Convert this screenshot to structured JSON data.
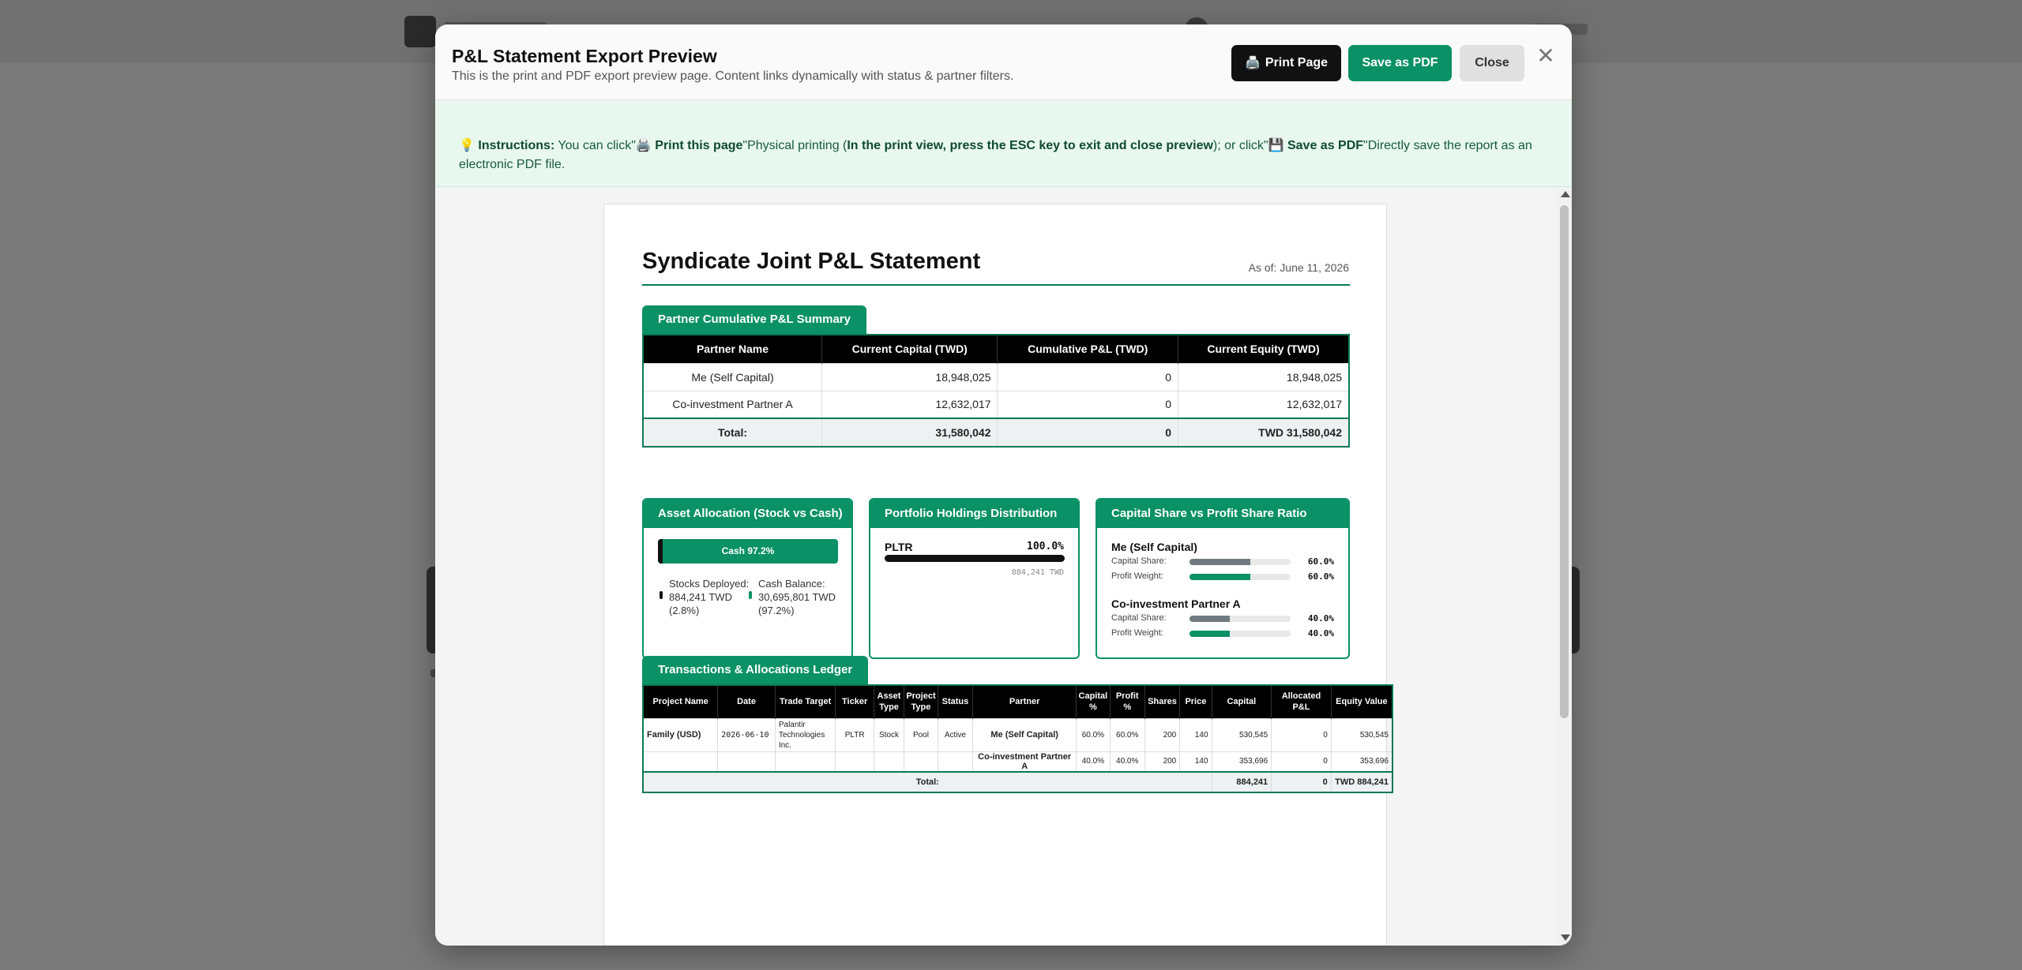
{
  "modal": {
    "title": "P&L Statement Export Preview",
    "subtitle": "This is the print and PDF export preview page. Content links dynamically with status & partner filters.",
    "print_label": "Print Page",
    "pdf_label": "Save as PDF",
    "close_label": "Close",
    "x_glyph": "✕"
  },
  "instructions": {
    "icon": "💡",
    "lead": "Instructions:",
    "t1": " You can click\"",
    "print_icon": "🖨️",
    "print_text": " Print this page",
    "t2": "\"Physical printing (",
    "bold_note": "In the print view, press the ESC key to exit and close preview",
    "t3": "); or click\"",
    "pdf_icon": "💾",
    "pdf_text": " Save as PDF",
    "t4": "\"Directly save the report as an electronic PDF file."
  },
  "report": {
    "title": "Syndicate Joint P&L Statement",
    "as_of": "As of: June 11, 2026"
  },
  "summary": {
    "tab": "Partner Cumulative P&L Summary",
    "headers": [
      "Partner Name",
      "Current Capital (TWD)",
      "Cumulative P&L (TWD)",
      "Current Equity (TWD)"
    ],
    "rows": [
      [
        "Me (Self Capital)",
        "18,948,025",
        "0",
        "18,948,025"
      ],
      [
        "Co-investment Partner A",
        "12,632,017",
        "0",
        "12,632,017"
      ]
    ],
    "total": [
      "Total:",
      "31,580,042",
      "0",
      "TWD 31,580,042"
    ]
  },
  "allocation": {
    "title": "Asset Allocation (Stock vs Cash)",
    "bar_label": "Cash 97.2%",
    "stock_fraction": 0.028,
    "stock_legend": "Stocks Deployed: 884,241 TWD (2.8%)",
    "cash_legend": "Cash Balance: 30,695,801 TWD (97.2%)",
    "stock_color": "#111111",
    "cash_color": "#0a9165"
  },
  "holdings": {
    "title": "Portfolio Holdings Distribution",
    "items": [
      {
        "ticker": "PLTR",
        "pct": "100.0%",
        "fraction": 1.0,
        "value": "884,241 TWD"
      }
    ]
  },
  "share_ratio": {
    "title": "Capital Share vs Profit Share Ratio",
    "partners": [
      {
        "name": "Me (Self Capital)",
        "cap_label": "Capital Share:",
        "cap_pct": "60.0%",
        "cap_fraction": 0.6,
        "pro_label": "Profit Weight:",
        "pro_pct": "60.0%",
        "pro_fraction": 0.6
      },
      {
        "name": "Co-investment Partner A",
        "cap_label": "Capital Share:",
        "cap_pct": "40.0%",
        "cap_fraction": 0.4,
        "pro_label": "Profit Weight:",
        "pro_pct": "40.0%",
        "pro_fraction": 0.4
      }
    ]
  },
  "ledger": {
    "tab": "Transactions & Allocations Ledger",
    "headers": [
      "Project Name",
      "Date",
      "Trade Target",
      "Ticker",
      "Asset Type",
      "Project Type",
      "Status",
      "Partner",
      "Capital %",
      "Profit %",
      "Shares",
      "Price",
      "Capital",
      "Allocated P&L",
      "Equity Value"
    ],
    "row1": [
      "Family (USD)",
      "2026-06-10",
      "Palantir Technologies Inc.",
      "PLTR",
      "Stock",
      "Pool",
      "Active",
      "Me (Self Capital)",
      "60.0%",
      "60.0%",
      "200",
      "140",
      "530,545",
      "0",
      "530,545"
    ],
    "row2": [
      "Co-investment Partner A",
      "40.0%",
      "40.0%",
      "200",
      "140",
      "353,696",
      "0",
      "353,696"
    ],
    "total": [
      "Total:",
      "884,241",
      "0",
      "TWD 884,241"
    ]
  }
}
